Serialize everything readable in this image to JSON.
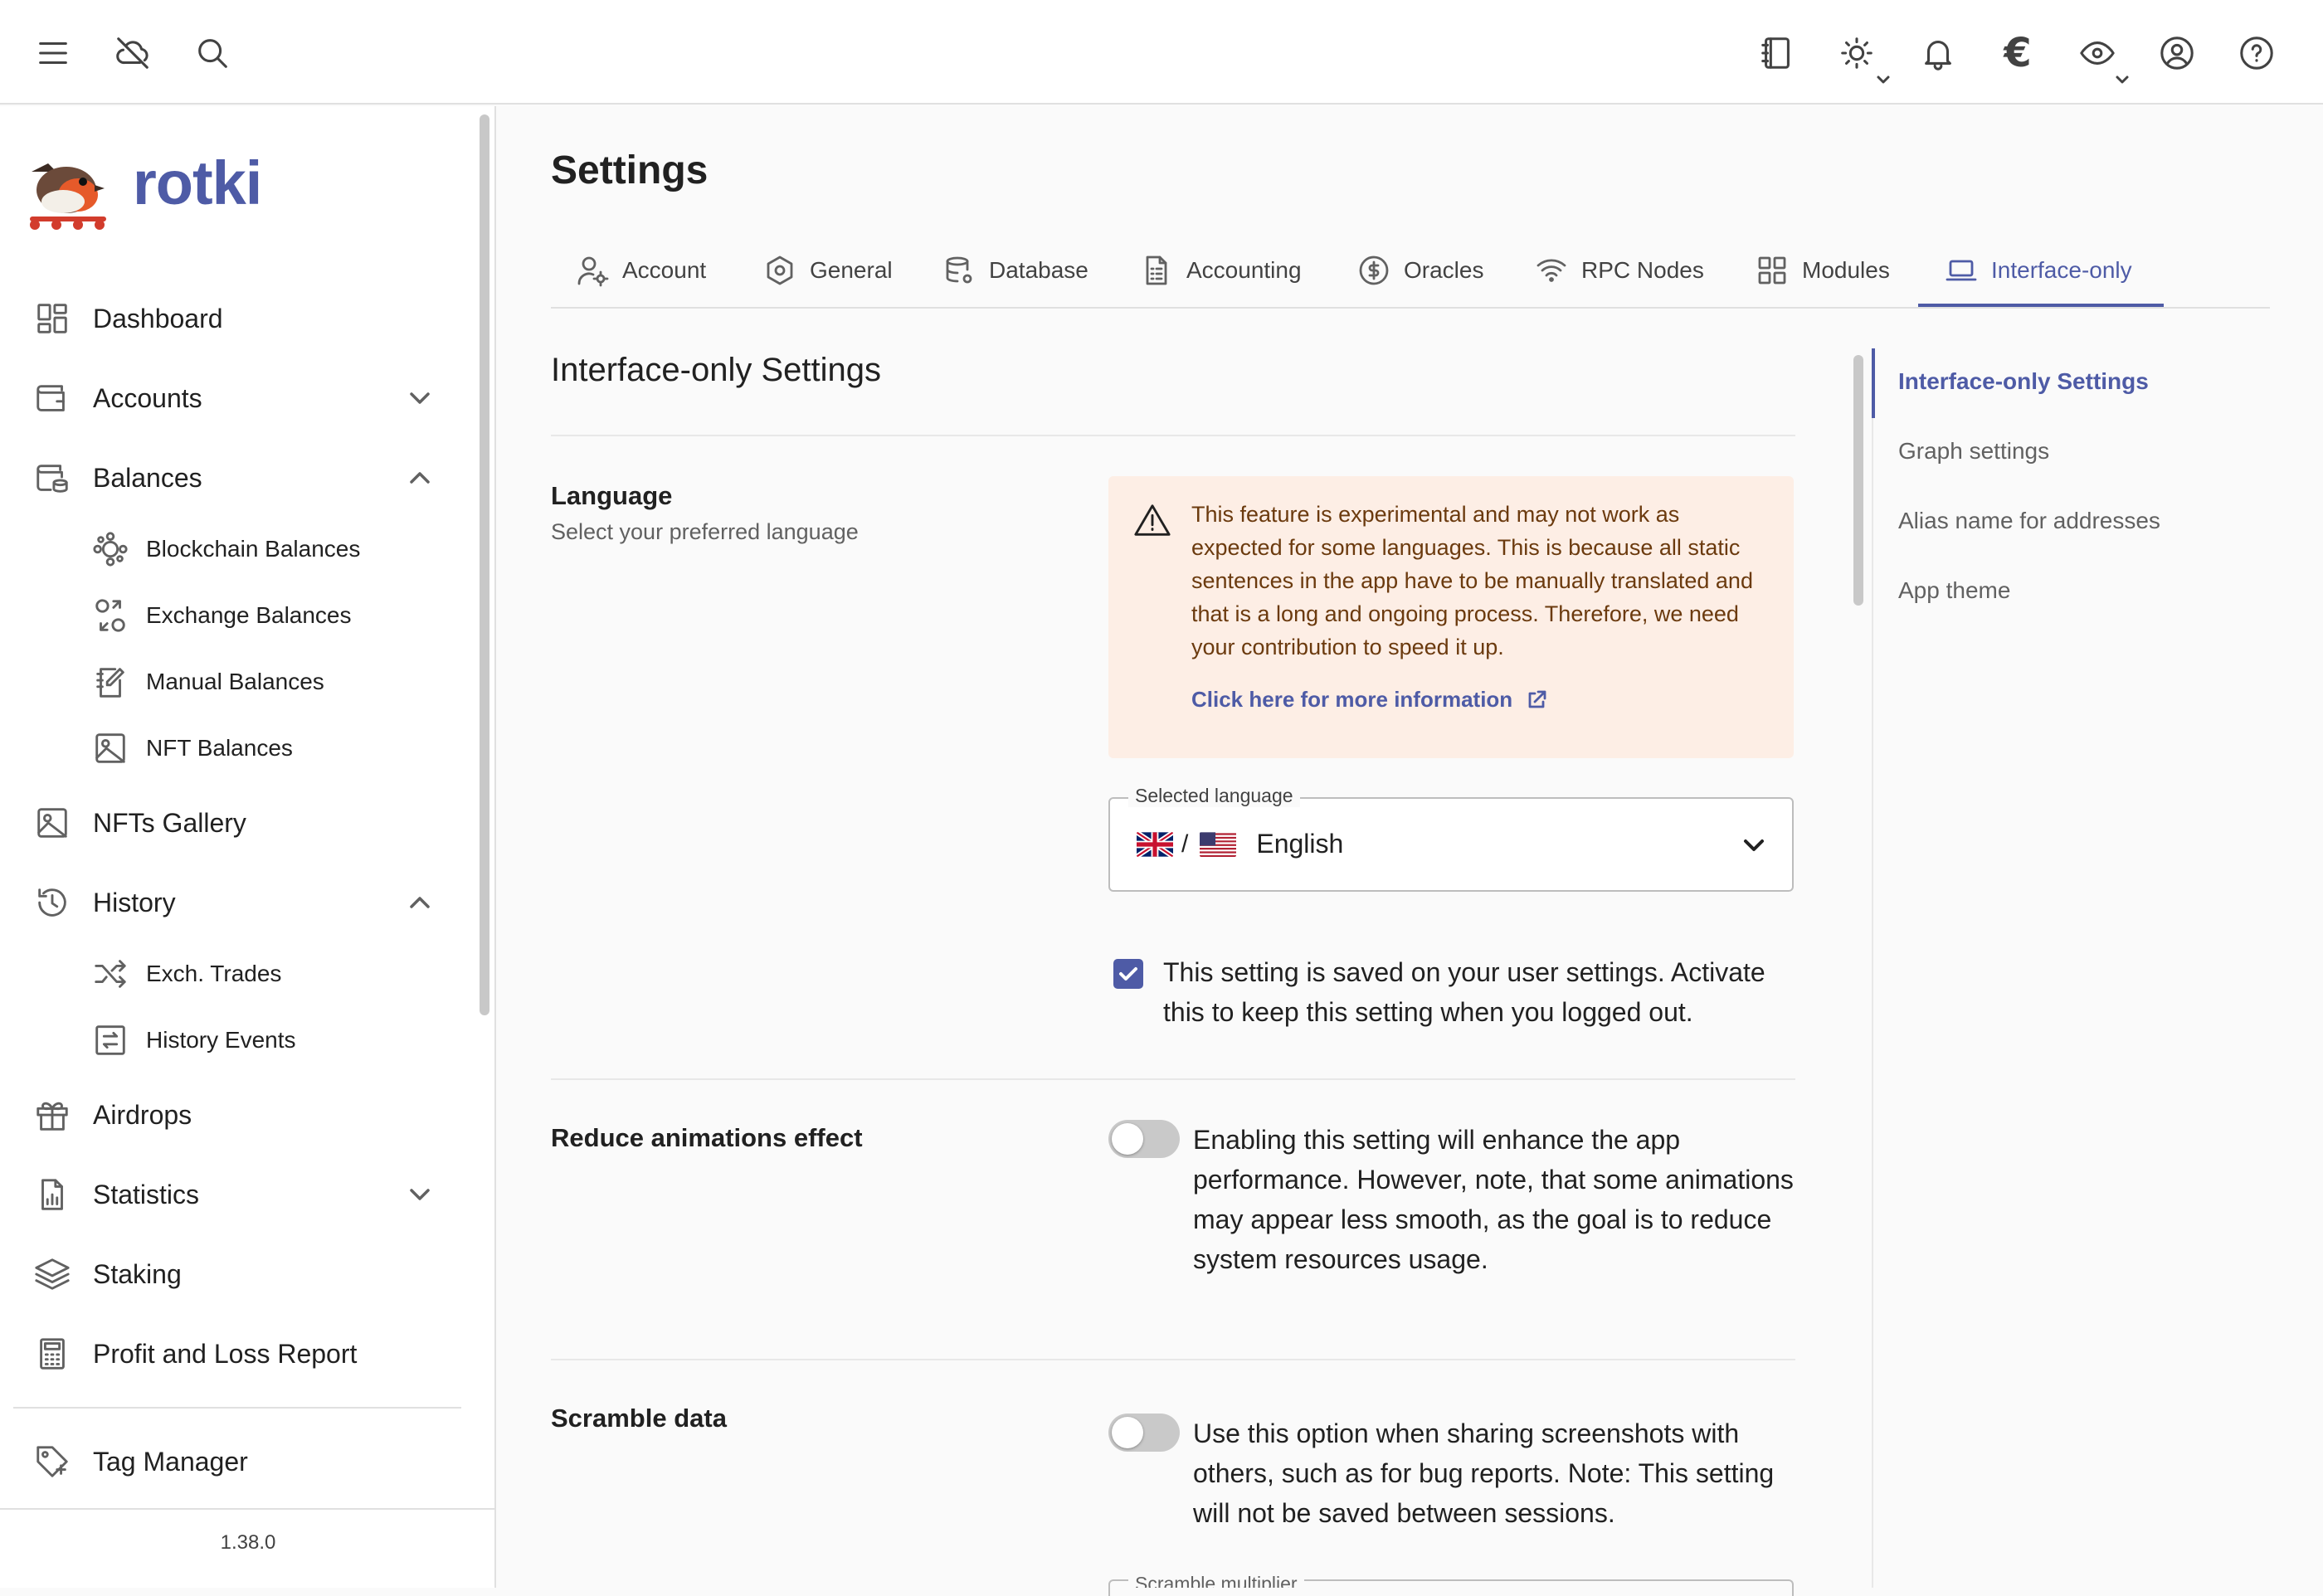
{
  "topbar": {
    "icons": [
      "menu-icon",
      "cloud-off-icon",
      "search-icon",
      "notes-icon",
      "theme-sun-icon",
      "bell-icon",
      "currency-euro-icon",
      "eye-icon",
      "user-circle-icon",
      "help-icon"
    ],
    "currency": "€"
  },
  "brand": {
    "name": "rotki"
  },
  "sidebar": {
    "items": [
      {
        "label": "Dashboard"
      },
      {
        "label": "Accounts"
      },
      {
        "label": "Balances"
      },
      {
        "label": "NFTs Gallery"
      },
      {
        "label": "History"
      },
      {
        "label": "Airdrops"
      },
      {
        "label": "Statistics"
      },
      {
        "label": "Staking"
      },
      {
        "label": "Profit and Loss Report"
      },
      {
        "label": "Tag Manager"
      }
    ],
    "balances_sub": [
      {
        "label": "Blockchain Balances"
      },
      {
        "label": "Exchange Balances"
      },
      {
        "label": "Manual Balances"
      },
      {
        "label": "NFT Balances"
      }
    ],
    "history_sub": [
      {
        "label": "Exch. Trades"
      },
      {
        "label": "History Events"
      }
    ],
    "version": "1.38.0"
  },
  "main": {
    "title": "Settings",
    "tabs": [
      {
        "label": "Account"
      },
      {
        "label": "General"
      },
      {
        "label": "Database"
      },
      {
        "label": "Accounting"
      },
      {
        "label": "Oracles"
      },
      {
        "label": "RPC Nodes"
      },
      {
        "label": "Modules"
      },
      {
        "label": "Interface-only"
      }
    ],
    "section_title": "Interface-only Settings",
    "language": {
      "label": "Language",
      "sub": "Select your preferred language",
      "alert": "This feature is experimental and may not work as expected for some languages. This is because all static sentences in the app have to be manually translated and that is a long and ongoing process. Therefore, we need your contribution to speed it up.",
      "alert_link": "Click here for more information",
      "select_legend": "Selected language",
      "separator": "/",
      "selected": "English",
      "checkbox_text": "This setting is saved on your user settings. Activate this to keep this setting when you logged out.",
      "checkbox_checked": true
    },
    "animations": {
      "label": "Reduce animations effect",
      "text": "Enabling this setting will enhance the app performance. However, note, that some animations may appear less smooth, as the goal is to reduce system resources usage.",
      "enabled": false
    },
    "scramble": {
      "label": "Scramble data",
      "text": "Use this option when sharing screenshots with others, such as for bug reports. Note: This setting will not be saved between sessions.",
      "enabled": false,
      "multiplier_label": "Scramble multiplier"
    }
  },
  "toc": {
    "items": [
      {
        "label": "Interface-only Settings"
      },
      {
        "label": "Graph settings"
      },
      {
        "label": "Alias name for addresses"
      },
      {
        "label": "App theme"
      }
    ]
  },
  "colors": {
    "accent": "#4e5ba6",
    "alert_bg": "#fdeee5",
    "alert_text": "#6b3a0e"
  }
}
